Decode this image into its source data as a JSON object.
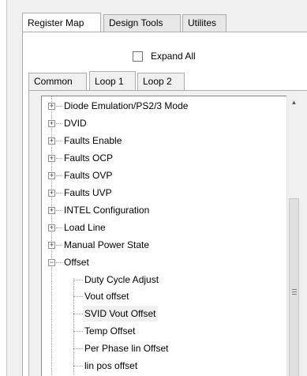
{
  "main_tabs": [
    {
      "label": "Register Map",
      "active": true
    },
    {
      "label": "Design Tools",
      "active": false
    },
    {
      "label": "Utilites",
      "active": false
    }
  ],
  "expand_all": {
    "label": "Expand All",
    "checked": false
  },
  "loop_tabs": [
    {
      "label": "Common",
      "active": false
    },
    {
      "label": "Loop 1",
      "active": true
    },
    {
      "label": "Loop 2",
      "active": false
    }
  ],
  "tree": {
    "nodes": [
      {
        "label": "Diode Emulation/PS2/3 Mode",
        "expander": "+"
      },
      {
        "label": "DVID",
        "expander": "+"
      },
      {
        "label": "Faults Enable",
        "expander": "+"
      },
      {
        "label": "Faults OCP",
        "expander": "+"
      },
      {
        "label": "Faults OVP",
        "expander": "+"
      },
      {
        "label": "Faults UVP",
        "expander": "+"
      },
      {
        "label": "INTEL Configuration",
        "expander": "+"
      },
      {
        "label": "Load Line",
        "expander": "+"
      },
      {
        "label": "Manual Power State",
        "expander": "+"
      },
      {
        "label": "Offset",
        "expander": "−"
      }
    ],
    "children": [
      {
        "label": "Duty Cycle Adjust"
      },
      {
        "label": "Vout offset"
      },
      {
        "label": "SVID Vout Offset",
        "selected": true
      },
      {
        "label": "Temp Offset"
      },
      {
        "label": "Per Phase lin Offset"
      },
      {
        "label": "lin pos offset"
      }
    ]
  },
  "scrollbar": {
    "up_arrow": "▲"
  }
}
